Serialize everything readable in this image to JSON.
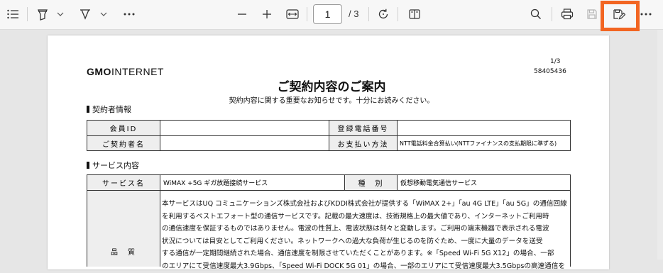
{
  "toolbar": {
    "page_current": "1",
    "page_total": "/ 3",
    "buttons": [
      "contents-icon",
      "highlight-icon",
      "draw-icon",
      "more-tools-icon",
      "zoom-out-icon",
      "zoom-in-icon",
      "fit-page-icon",
      "rotate-icon",
      "page-view-icon",
      "search-icon",
      "print-icon",
      "save-icon",
      "save-as-icon",
      "more-options-icon"
    ],
    "highlight_color": "#f26522"
  },
  "document": {
    "logo_bold": "GMO",
    "logo_rest": "INTERNET",
    "page_no": "1/3",
    "doc_id": "58405436",
    "title": "ご契約内容のご案内",
    "subtitle": "契約内容に関する重要なお知らせです。十分にお読みください。",
    "section1": "契約者情報",
    "contract_table": {
      "member_id_label": "会員ID",
      "member_id_value": "",
      "phone_label": "登録電話番号",
      "phone_value": "",
      "name_label": "ご契約者名",
      "name_value": "",
      "payment_label": "お支払い方法",
      "payment_value": "NTT電話料金合算払い(NTTファイナンスの支払期限に準ずる)"
    },
    "section2": "サービス内容",
    "service_table": {
      "service_label": "サービス名",
      "service_value": "WiMAX +5G ギガ放題接続サービス",
      "type_label": "種　別",
      "type_value": "仮想移動電気通信サービス",
      "quality_label": "品　質",
      "quality_lines": [
        "本サービスはUQ コミュニケーションズ株式会社およびKDDI株式会社が提供する「WiMAX 2+」「au 4G LTE」「au 5G」の通信回線",
        "を利用するベストエフォート型の通信サービスです。記載の最大速度は、技術規格上の最大値であり、インターネットご利用時",
        "の通信速度を保証するものではありません。電波の性質上、電波状態は刻々と変動します。ご利用の端末機器で表示される電波",
        "状況については目安としてご利用ください。ネットワークへの過大な負荷が生じるのを防ぐため、一度に大量のデータを送受",
        "する通信が一定期間継続された場合、通信速度を制限させていただくことがあります。※「Speed Wi-Fi 5G X12」の場合、一部",
        "のエリアにて受信速度最大3.9Gbps、「Speed Wi-Fi DOCK 5G 01」の場合、一部のエリアにて受信速度最大3.5Gbpsの高速通信を"
      ]
    }
  }
}
